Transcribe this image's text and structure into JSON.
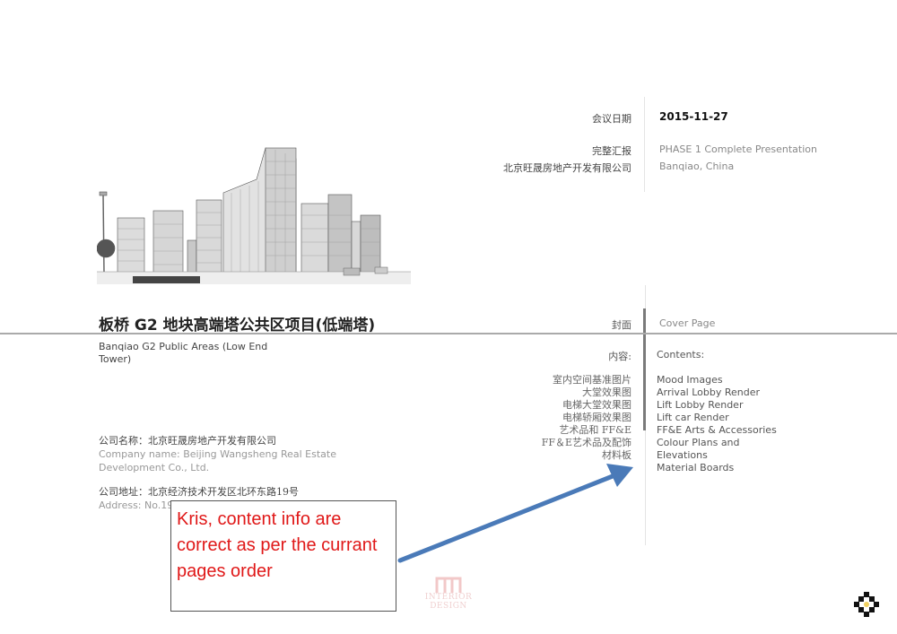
{
  "meta": {
    "date_label": "会议日期",
    "date_value": "2015-11-27",
    "report_label": "完整汇报",
    "report_value": "PHASE 1 Complete Presentation",
    "client_label": "北京旺晟房地产开发有限公司",
    "client_value": "Banqiao, China"
  },
  "project": {
    "title_zh": "板桥 G2 地块高端塔公共区项目(低端塔)",
    "title_en": "Banqiao G2 Public Areas (Low End Tower)"
  },
  "cover": {
    "label": "封面",
    "value": "Cover Page"
  },
  "contents": {
    "label": "内容:",
    "value": "Contents:",
    "items_zh": [
      "室内空间基准图片",
      "大堂效果图",
      "电梯大堂效果图",
      "电梯轿厢效果图",
      "艺术品和 FF&E",
      "FF＆E艺术品及配饰",
      "材料板"
    ],
    "items_en": [
      "Mood Images",
      "Arrival Lobby Render",
      "Lift Lobby Render",
      "Lift car Render",
      "FF&E Arts & Accessories",
      "Colour Plans and",
      "Elevations",
      "Material Boards"
    ]
  },
  "company": {
    "name_zh": "公司名称：北京旺晟房地产开发有限公司",
    "name_en": "Company name:  Beijing Wangsheng Real Estate Development Co., Ltd.",
    "address_zh": "公司地址：北京经济技术开发区北环东路19号",
    "address_en": "Address:  No.19"
  },
  "annotation": {
    "text": "Kris, content info are correct as per the currant pages order",
    "text_color": "#e01818",
    "arrow_color": "#4a7ab8"
  },
  "watermark": {
    "text": "INTERIOR DESIGN"
  },
  "illustration": {
    "subject": "city-towers-sketch"
  }
}
